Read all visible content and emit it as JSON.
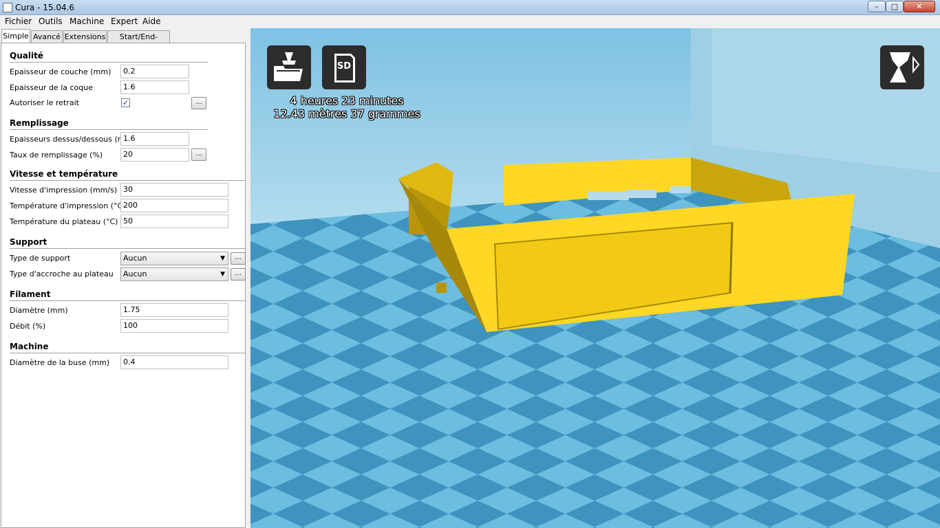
{
  "window": {
    "title": "Cura - 15.04.6",
    "minimize_label": "–",
    "maximize_label": "□",
    "close_label": "✕"
  },
  "menu": [
    "Fichier",
    "Outils",
    "Machine",
    "Expert",
    "Aide"
  ],
  "tabs": [
    "Simple",
    "Avancé",
    "Extensions",
    "Start/End-GCode"
  ],
  "sections": {
    "quality": {
      "title": "Qualité",
      "layer_height": {
        "label": "Epaisseur de couche (mm)",
        "value": "0.2"
      },
      "shell_thickness": {
        "label": "Epaisseur de la coque",
        "value": "1.6"
      },
      "retraction": {
        "label": "Autoriser le retrait",
        "checked": true,
        "more": "..."
      }
    },
    "fill": {
      "title": "Remplissage",
      "bottom_top": {
        "label": "Epaisseurs dessus/dessous (mm)",
        "value": "1.6"
      },
      "fill_density": {
        "label": "Taux de remplissage (%)",
        "value": "20",
        "more": "..."
      }
    },
    "speed": {
      "title": "Vitesse et température",
      "print_speed": {
        "label": "Vitesse d'impression (mm/s)",
        "value": "30"
      },
      "print_temp": {
        "label": "Température d'impression (°C)",
        "value": "200"
      },
      "bed_temp": {
        "label": "Température du plateau (°C)",
        "value": "50"
      }
    },
    "support": {
      "title": "Support",
      "support_type": {
        "label": "Type de support",
        "value": "Aucun",
        "more": "..."
      },
      "adhesion": {
        "label": "Type d'accroche au plateau",
        "value": "Aucun",
        "more": "..."
      }
    },
    "filament": {
      "title": "Filament",
      "diameter": {
        "label": "Diamètre (mm)",
        "value": "1.75"
      },
      "flow": {
        "label": "Débit (%)",
        "value": "100"
      }
    },
    "machine": {
      "title": "Machine",
      "nozzle": {
        "label": "Diamètre de la buse (mm)",
        "value": "0.4"
      }
    }
  },
  "viewport": {
    "load_icon": "load-model-icon",
    "sd_icon": "sd-card-icon",
    "sd_label": "SD",
    "view_mode_icon": "view-mode-icon",
    "print_time": "4 heures 23 minutes",
    "print_material": "12.43 mètres 37 grammes",
    "colors": {
      "model": "#ffd724",
      "grid_light": "#6cbde0",
      "grid_dark": "#3e93bf"
    }
  }
}
